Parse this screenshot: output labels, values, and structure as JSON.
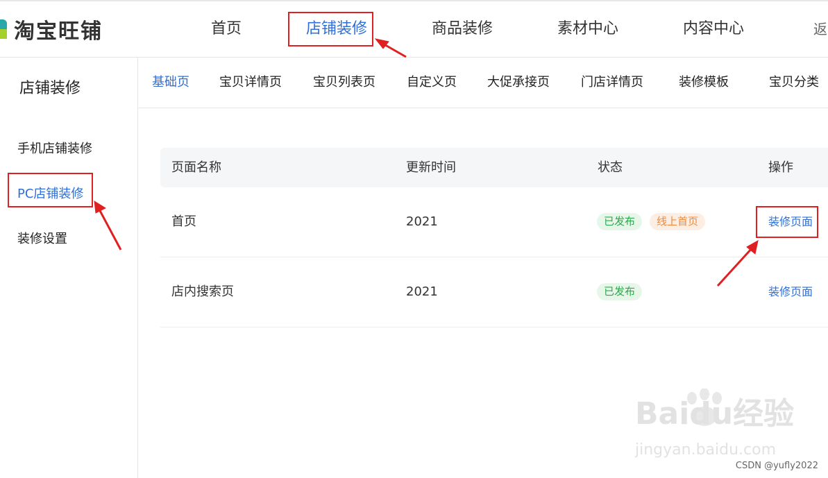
{
  "header": {
    "logo_text": "淘宝旺铺",
    "nav": [
      "首页",
      "店铺装修",
      "商品装修",
      "素材中心",
      "内容中心",
      "返"
    ]
  },
  "sidebar": {
    "title": "店铺装修",
    "items": [
      "手机店铺装修",
      "PC店铺装修",
      "装修设置"
    ]
  },
  "subtabs": [
    "基础页",
    "宝贝详情页",
    "宝贝列表页",
    "自定义页",
    "大促承接页",
    "门店详情页",
    "装修模板",
    "宝贝分类"
  ],
  "table": {
    "headers": [
      "页面名称",
      "更新时间",
      "状态",
      "操作"
    ],
    "rows": [
      {
        "name": "首页",
        "time": "2021",
        "status": [
          "已发布",
          "线上首页"
        ],
        "action": "装修页面"
      },
      {
        "name": "店内搜索页",
        "time": "2021",
        "status": [
          "已发布"
        ],
        "action": "装修页面"
      }
    ]
  },
  "watermark": {
    "brand": "Baidu经验",
    "url": "jingyan.baidu.com"
  },
  "credit": "CSDN @yufly2022",
  "colors": {
    "accent": "#2f6fd8",
    "highlight_box": "#e02020",
    "published": "#2ca84a",
    "online": "#ee8a3c"
  }
}
